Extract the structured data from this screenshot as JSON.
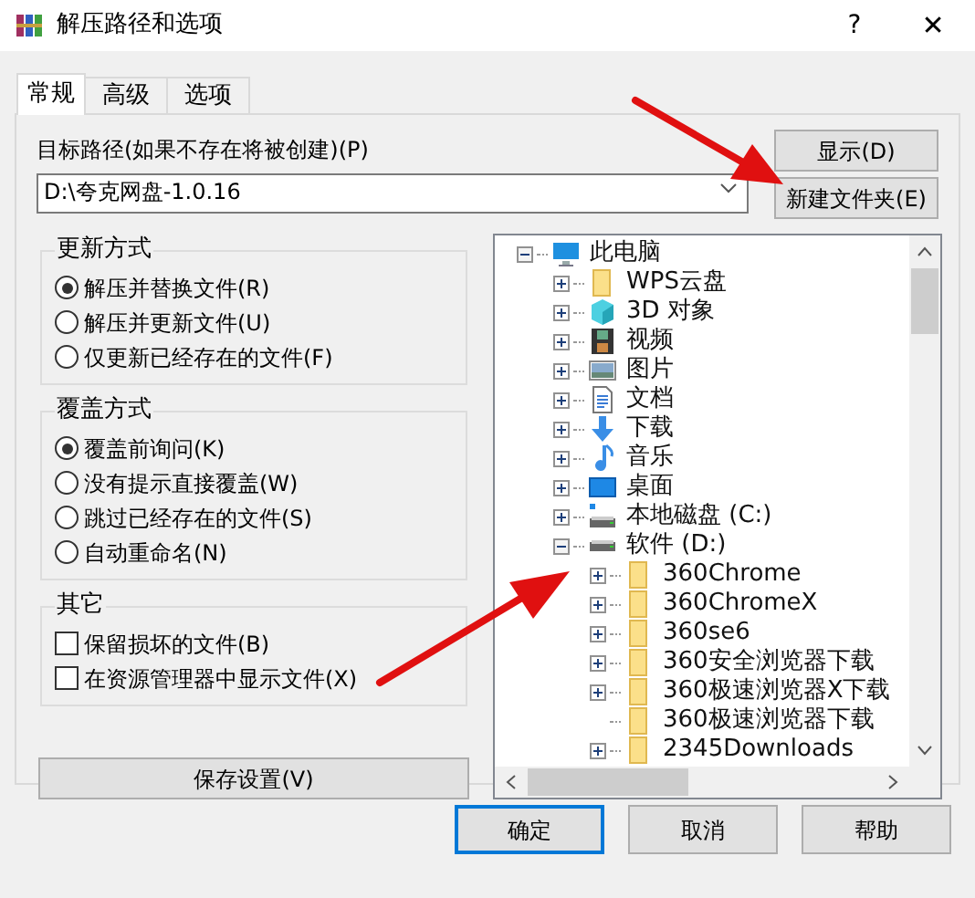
{
  "window": {
    "title": "解压路径和选项",
    "help": "?",
    "close": "✕"
  },
  "tabs": [
    {
      "label": "常规",
      "selected": true
    },
    {
      "label": "高级",
      "selected": false
    },
    {
      "label": "选项",
      "selected": false
    }
  ],
  "path": {
    "label": "目标路径(如果不存在将被创建)(P)",
    "value": "D:\\夸克网盘-1.0.16"
  },
  "side_buttons": [
    "显示(D)",
    "新建文件夹(E)"
  ],
  "update_mode": {
    "title": "更新方式",
    "options": [
      {
        "label": "解压并替换文件(R)",
        "selected": true
      },
      {
        "label": "解压并更新文件(U)",
        "selected": false
      },
      {
        "label": "仅更新已经存在的文件(F)",
        "selected": false
      }
    ]
  },
  "overwrite_mode": {
    "title": "覆盖方式",
    "options": [
      {
        "label": "覆盖前询问(K)",
        "selected": true
      },
      {
        "label": "没有提示直接覆盖(W)",
        "selected": false
      },
      {
        "label": "跳过已经存在的文件(S)",
        "selected": false
      },
      {
        "label": "自动重命名(N)",
        "selected": false
      }
    ]
  },
  "other": {
    "title": "其它",
    "options": [
      {
        "label": "保留损坏的文件(B)",
        "checked": false
      },
      {
        "label": "在资源管理器中显示文件(X)",
        "checked": false
      }
    ]
  },
  "save_button": "保存设置(V)",
  "tree": [
    {
      "label": "此电脑",
      "kind": "computer",
      "expanded": true,
      "expandable": true,
      "children": [
        {
          "label": "WPS云盘",
          "kind": "folder",
          "expanded": false,
          "expandable": true
        },
        {
          "label": "3D 对象",
          "kind": "cube",
          "expanded": false,
          "expandable": true
        },
        {
          "label": "视频",
          "kind": "video",
          "expanded": false,
          "expandable": true
        },
        {
          "label": "图片",
          "kind": "picture",
          "expanded": false,
          "expandable": true
        },
        {
          "label": "文档",
          "kind": "document",
          "expanded": false,
          "expandable": true
        },
        {
          "label": "下载",
          "kind": "download",
          "expanded": false,
          "expandable": true
        },
        {
          "label": "音乐",
          "kind": "music",
          "expanded": false,
          "expandable": true
        },
        {
          "label": "桌面",
          "kind": "desktop",
          "expanded": false,
          "expandable": true
        },
        {
          "label": "本地磁盘 (C:)",
          "kind": "system-drive",
          "expanded": false,
          "expandable": true
        },
        {
          "label": "软件 (D:)",
          "kind": "drive",
          "expanded": true,
          "expandable": true,
          "children": [
            {
              "label": "360Chrome",
              "kind": "folder",
              "expanded": false,
              "expandable": true
            },
            {
              "label": "360ChromeX",
              "kind": "folder",
              "expanded": false,
              "expandable": true
            },
            {
              "label": "360se6",
              "kind": "folder",
              "expanded": false,
              "expandable": true
            },
            {
              "label": "360安全浏览器下载",
              "kind": "folder",
              "expanded": false,
              "expandable": true
            },
            {
              "label": "360极速浏览器X下载",
              "kind": "folder",
              "expanded": false,
              "expandable": true
            },
            {
              "label": "360极速浏览器下载",
              "kind": "folder",
              "expandable": false
            },
            {
              "label": "2345Downloads",
              "kind": "folder",
              "expanded": false,
              "expandable": true
            }
          ]
        }
      ]
    }
  ],
  "dialog_buttons": [
    {
      "label": "确定",
      "selected": true
    },
    {
      "label": "取消",
      "selected": false
    },
    {
      "label": "帮助",
      "selected": false
    }
  ]
}
